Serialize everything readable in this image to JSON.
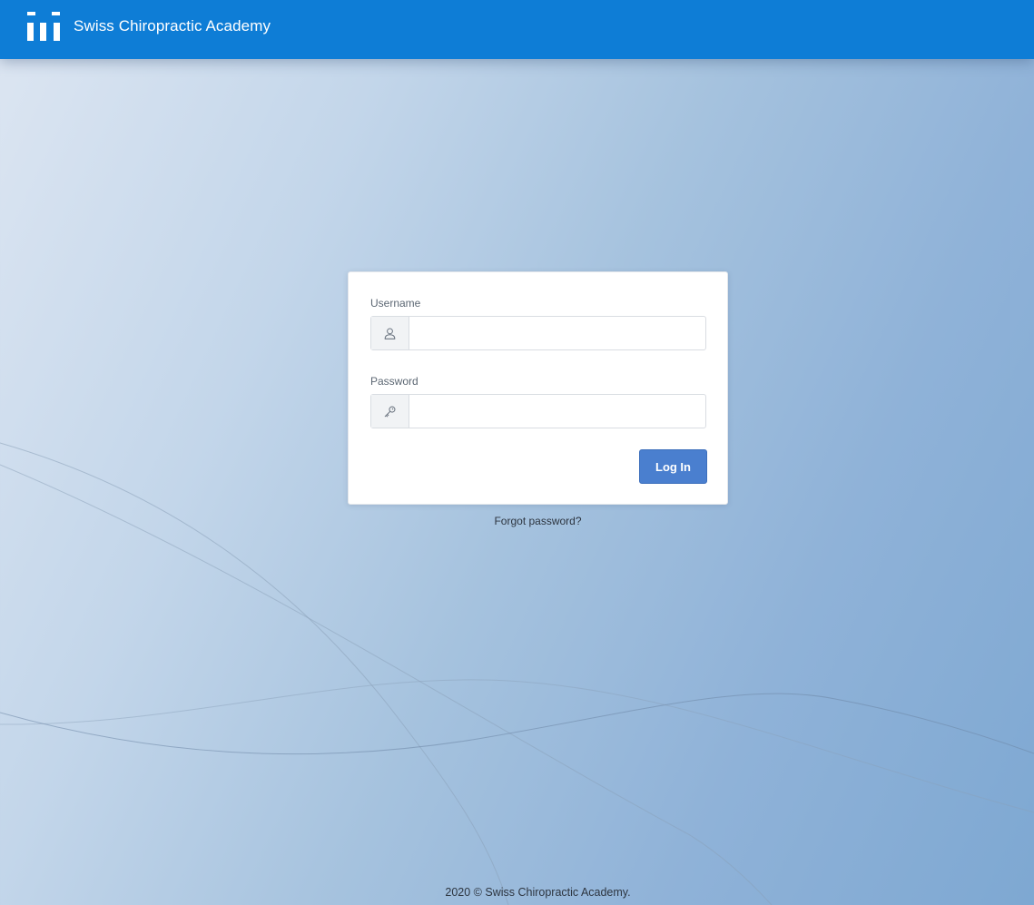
{
  "header": {
    "brand_name": "Swiss Chiropractic Academy",
    "logo_icon": "columns-logo-icon",
    "background_color": "#0e7dd6"
  },
  "login_form": {
    "username": {
      "label": "Username",
      "value": "",
      "placeholder": "",
      "icon": "user-icon"
    },
    "password": {
      "label": "Password",
      "value": "",
      "placeholder": "",
      "icon": "key-icon"
    },
    "submit_label": "Log In",
    "submit_color": "#4a7fcf"
  },
  "forgot_password_label": "Forgot password?",
  "footer_text": "2020 © Swiss Chiropractic Academy."
}
